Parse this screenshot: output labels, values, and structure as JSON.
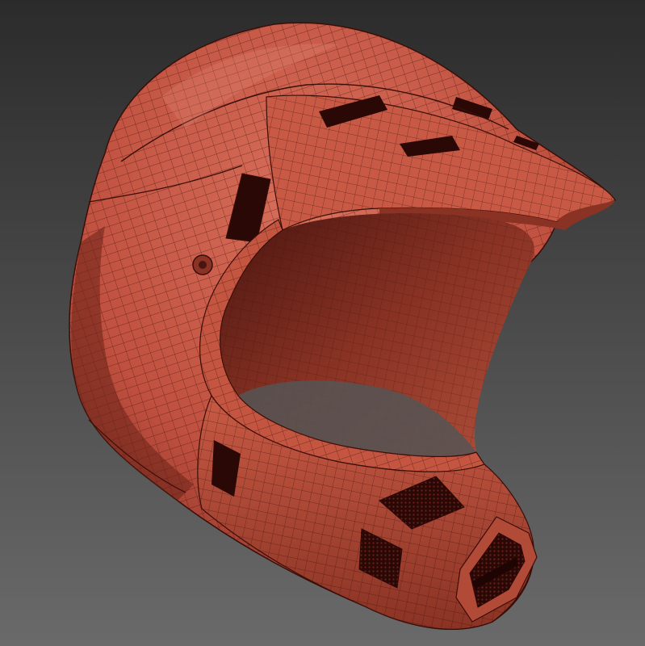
{
  "scene": {
    "subject": "helmet-wireframe",
    "colors": {
      "background_top": "#2b2b2b",
      "background_bottom": "#6a6a6a",
      "shell_base": "#c0503f",
      "shell_light": "#d8705c",
      "shell_dark": "#7a2a20",
      "shell_deep": "#4a1510",
      "wire": "#3a0e08",
      "vent_hole": "#2a0806",
      "mesh": "#5a1a12"
    }
  }
}
